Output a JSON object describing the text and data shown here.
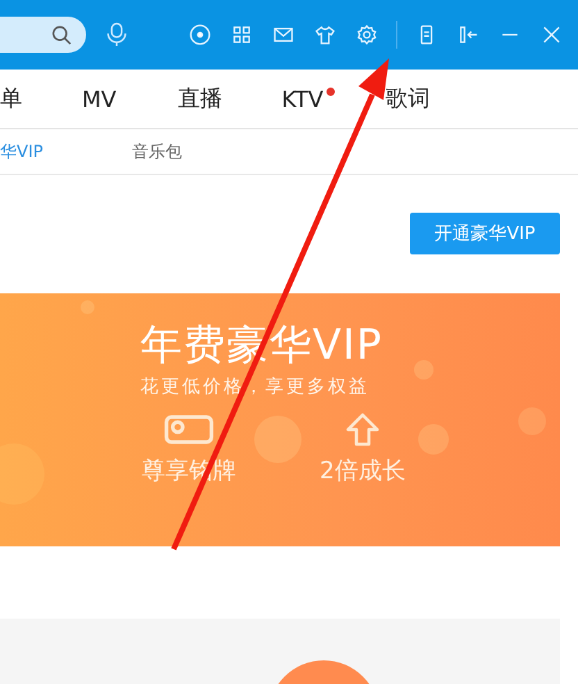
{
  "tabs": [
    {
      "label": "单",
      "selected": false,
      "badge": false
    },
    {
      "label": "MV",
      "selected": false,
      "badge": false
    },
    {
      "label": "直播",
      "selected": false,
      "badge": false
    },
    {
      "label": "KTV",
      "selected": false,
      "badge": true
    },
    {
      "label": "歌词",
      "selected": false,
      "badge": false
    }
  ],
  "subtabs": [
    {
      "label": "华VIP",
      "selected": true
    },
    {
      "label": "音乐包",
      "selected": false
    }
  ],
  "open_button": "开通豪华VIP",
  "banner": {
    "title": "年费豪华VIP",
    "subtitle": "花更低价格，享更多权益",
    "features": [
      {
        "kind": "badge",
        "label": "尊享铭牌"
      },
      {
        "kind": "growth",
        "label": "2倍成长"
      }
    ]
  }
}
